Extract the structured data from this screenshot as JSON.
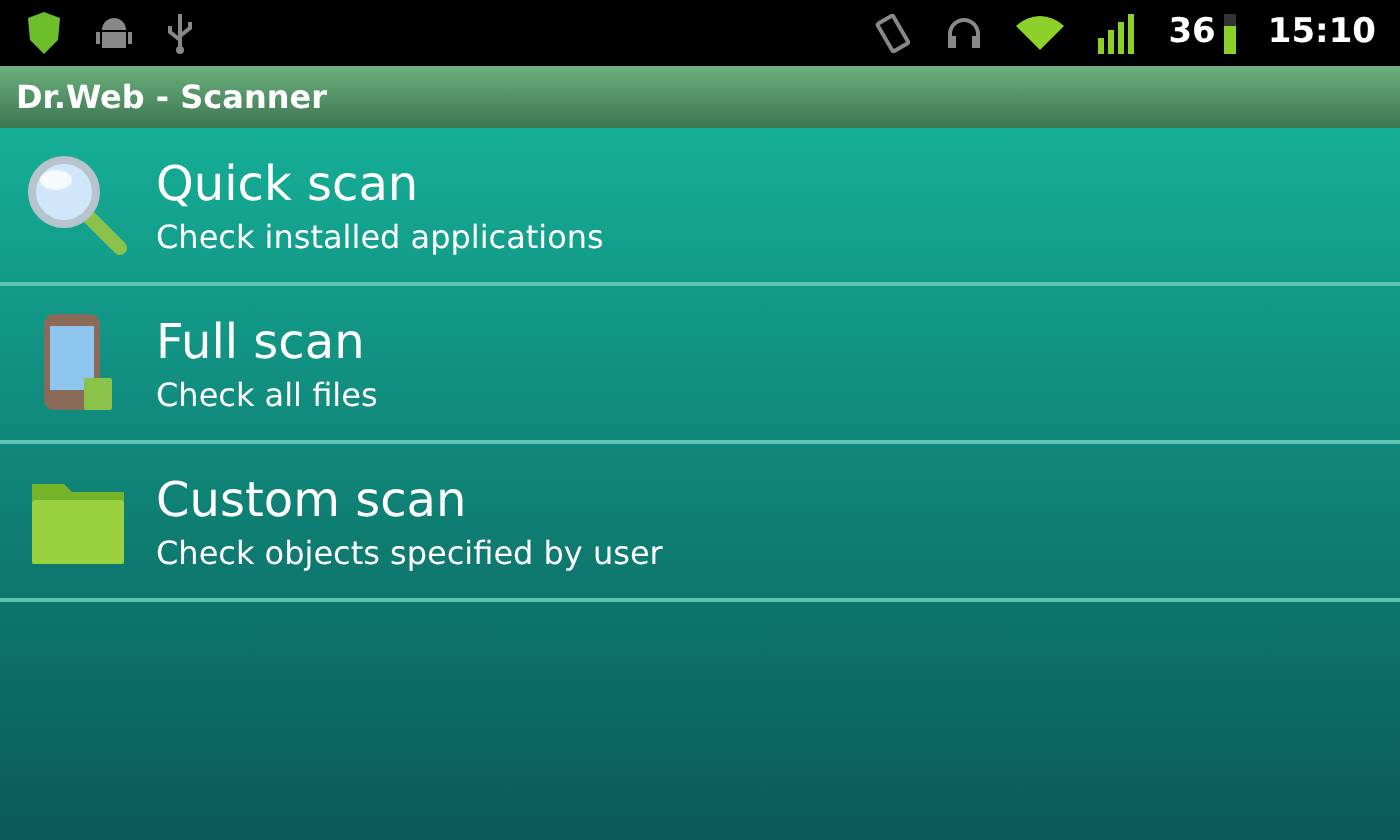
{
  "status_bar": {
    "battery": "36",
    "time": "15:10"
  },
  "title_bar": {
    "title": "Dr.Web - Scanner"
  },
  "scan_options": [
    {
      "kind": "quick",
      "title": "Quick scan",
      "subtitle": "Check installed applications"
    },
    {
      "kind": "full",
      "title": "Full scan",
      "subtitle": "Check all files"
    },
    {
      "kind": "custom",
      "title": "Custom scan",
      "subtitle": "Check objects specified by user"
    }
  ]
}
